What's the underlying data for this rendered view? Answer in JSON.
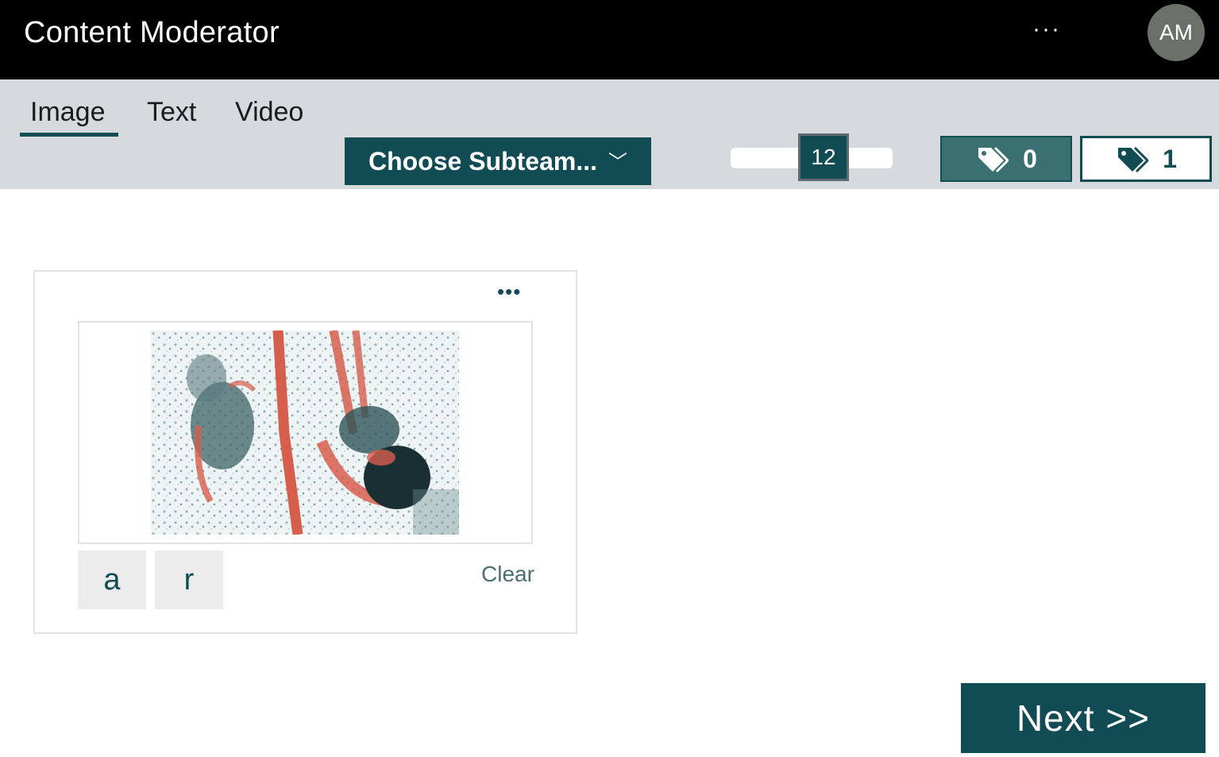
{
  "header": {
    "title": "Content Moderator",
    "more": "···",
    "avatar_initials": "AM"
  },
  "tabs": [
    {
      "label": "Image",
      "selected": true
    },
    {
      "label": "Text",
      "selected": false
    },
    {
      "label": "Video",
      "selected": false
    }
  ],
  "toolbar": {
    "subteam_label": "Choose Subteam...",
    "subteam_chevron": "﹀",
    "slider_value": "12",
    "tag_counts": [
      "0",
      "1"
    ]
  },
  "card": {
    "more": "•••",
    "keys": [
      "a",
      "r"
    ],
    "clear_label": "Clear"
  },
  "footer": {
    "next_label": "Next >>"
  },
  "colors": {
    "accent": "#114c55",
    "band": "#d6dadd",
    "lane_rope": "#d65e4d"
  }
}
